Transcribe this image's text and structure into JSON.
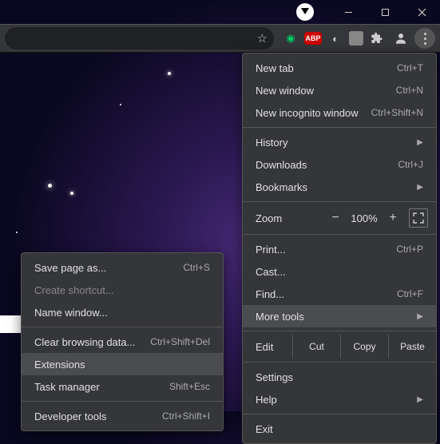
{
  "window": {
    "minimize": "–",
    "maximize": "▢",
    "close": "✕"
  },
  "toolbar": {
    "icons": [
      "grammarly",
      "abp",
      "dict",
      "translate",
      "extensions",
      "profile",
      "menu"
    ]
  },
  "menu": {
    "new_tab": "New tab",
    "new_tab_sc": "Ctrl+T",
    "new_window": "New window",
    "new_window_sc": "Ctrl+N",
    "new_incognito": "New incognito window",
    "new_incognito_sc": "Ctrl+Shift+N",
    "history": "History",
    "downloads": "Downloads",
    "downloads_sc": "Ctrl+J",
    "bookmarks": "Bookmarks",
    "zoom_label": "Zoom",
    "zoom_pct": "100%",
    "print": "Print...",
    "print_sc": "Ctrl+P",
    "cast": "Cast...",
    "find": "Find...",
    "find_sc": "Ctrl+F",
    "more_tools": "More tools",
    "edit": "Edit",
    "cut": "Cut",
    "copy": "Copy",
    "paste": "Paste",
    "settings": "Settings",
    "help": "Help",
    "exit": "Exit"
  },
  "submenu": {
    "save_page": "Save page as...",
    "save_page_sc": "Ctrl+S",
    "create_shortcut": "Create shortcut...",
    "name_window": "Name window...",
    "clear_browsing": "Clear browsing data...",
    "clear_browsing_sc": "Ctrl+Shift+Del",
    "extensions": "Extensions",
    "task_manager": "Task manager",
    "task_manager_sc": "Shift+Esc",
    "dev_tools": "Developer tools",
    "dev_tools_sc": "Ctrl+Shift+I"
  }
}
